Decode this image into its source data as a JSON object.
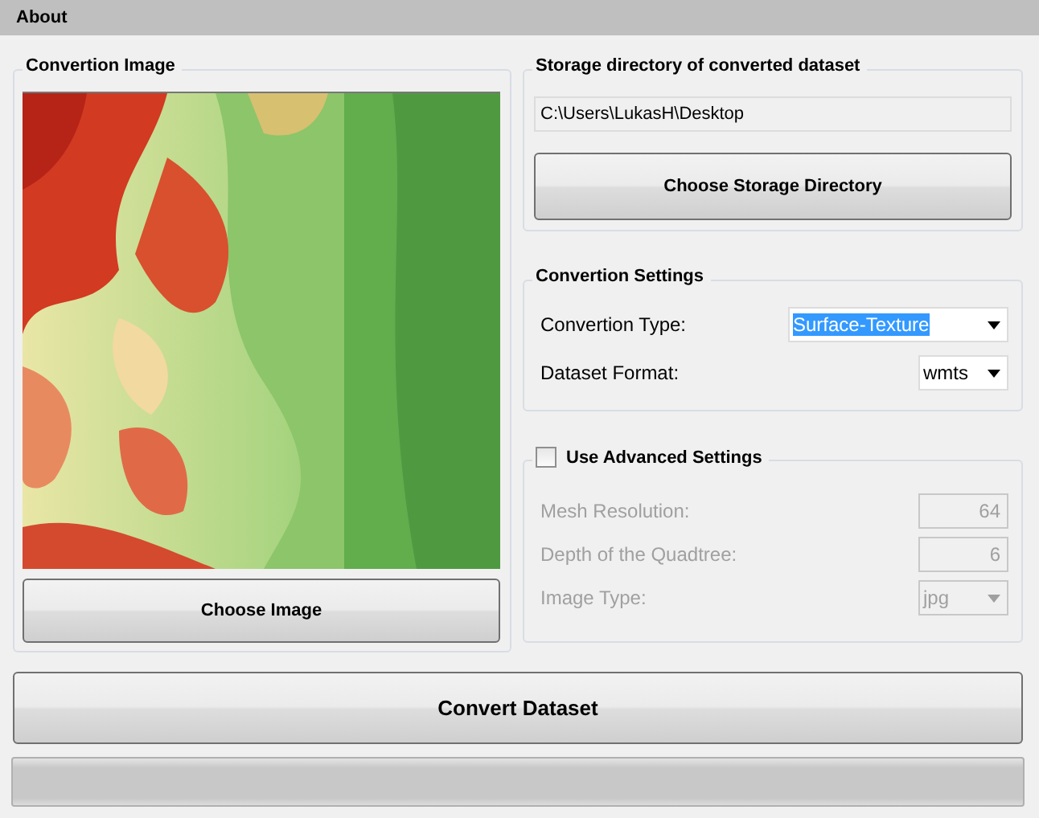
{
  "window": {
    "title": "About"
  },
  "image_group": {
    "title": "Convertion Image",
    "button": "Choose Image"
  },
  "storage_group": {
    "title": "Storage directory of converted dataset",
    "path": "C:\\Users\\LukasH\\Desktop",
    "button": "Choose Storage Directory"
  },
  "settings_group": {
    "title": "Convertion Settings",
    "fields": [
      {
        "label": "Convertion Type:",
        "value": "Surface-Texture",
        "kind": "dropdown",
        "highlighted": true,
        "disabled": false
      },
      {
        "label": "Dataset Format:",
        "value": "wmts",
        "kind": "dropdown",
        "highlighted": false,
        "disabled": false
      }
    ]
  },
  "advanced_group": {
    "title": "Use Advanced Settings",
    "checked": false,
    "fields": [
      {
        "label": "Mesh Resolution:",
        "value": "64",
        "kind": "number",
        "disabled": true
      },
      {
        "label": "Depth of the Quadtree:",
        "value": "6",
        "kind": "number",
        "disabled": true
      },
      {
        "label": "Image Type:",
        "value": "jpg",
        "kind": "dropdown",
        "disabled": true
      }
    ]
  },
  "convert_button": "Convert Dataset",
  "progress": {
    "level": 0
  }
}
